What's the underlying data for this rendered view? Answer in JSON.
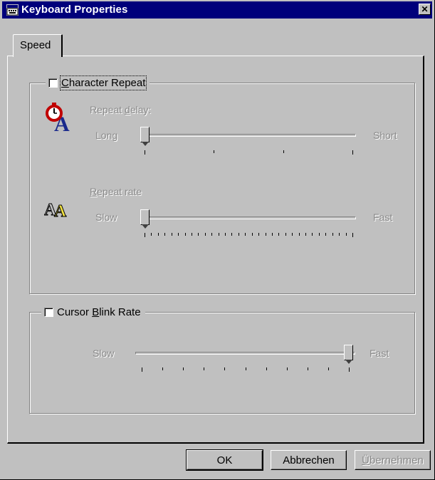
{
  "window": {
    "title": "Keyboard Properties",
    "close_symbol": "✕"
  },
  "tabs": [
    {
      "label": "Speed",
      "selected": true
    }
  ],
  "character_repeat": {
    "label_pre": "",
    "label_ul": "C",
    "label_post": "haracter Repeat",
    "checked": false,
    "icon": "stopwatch-letter-icon",
    "repeat_delay": {
      "label_pre": "Repeat ",
      "label_ul": "d",
      "label_post": "elay:",
      "min_label": "Long",
      "max_label": "Short",
      "position": 0,
      "ticks": 4
    },
    "repeat_rate": {
      "label_pre": "",
      "label_ul": "R",
      "label_post": "epeat rate",
      "min_label": "Slow",
      "max_label": "Fast",
      "icon": "repeat-letters-icon",
      "position": 0,
      "ticks": 32
    }
  },
  "cursor_blink": {
    "label_pre": "Cursor ",
    "label_ul": "B",
    "label_post": "link Rate",
    "checked": false,
    "min_label": "Slow",
    "max_label": "Fast",
    "position": 1,
    "ticks": 11
  },
  "buttons": {
    "ok": "OK",
    "cancel": "Abbrechen",
    "apply_ul": "Ü",
    "apply_rest": "bernehmen"
  },
  "colors": {
    "titlebar": "#00007b",
    "face": "#c0c0c0",
    "disabled_text": "#8a8a8a"
  }
}
